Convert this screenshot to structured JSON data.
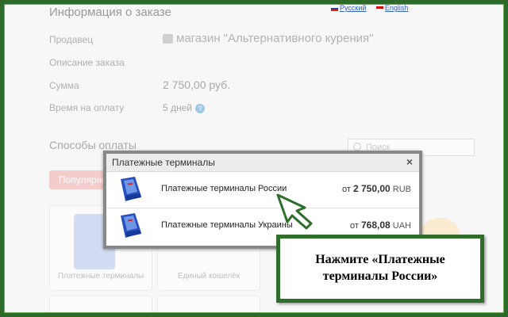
{
  "languages": [
    "Русский",
    "English"
  ],
  "order_info": {
    "title": "Информация о заказе",
    "seller_label": "Продавец",
    "seller_value": "магазин \"Альтернативного курения\"",
    "description_label": "Описание заказа",
    "sum_label": "Сумма",
    "sum_value": "2 750,00 руб.",
    "payment_time_label": "Время на оплату",
    "payment_time_value": "5 дней"
  },
  "payment_methods": {
    "title": "Способы оплаты",
    "search_placeholder": "Поиск",
    "tab_popular": "Популярные",
    "tiles": [
      "Платежные терминалы",
      "Единый кошелёк"
    ]
  },
  "modal": {
    "title": "Платежные терминалы",
    "close_glyph": "×",
    "options": [
      {
        "name": "Платежные терминалы России",
        "price_prefix": "от",
        "amount": "2 750,00",
        "currency": "RUB"
      },
      {
        "name": "Платежные терминалы Украины",
        "price_prefix": "от",
        "amount": "768,08",
        "currency": "UAH"
      }
    ]
  },
  "callout": {
    "line1": "Нажмите «Платежные",
    "line2": "терминалы России»"
  },
  "colors": {
    "frame_green": "#2d6a2a",
    "terminal_blue": "#2a4fbf",
    "muted_text": "#b0b0b0"
  }
}
